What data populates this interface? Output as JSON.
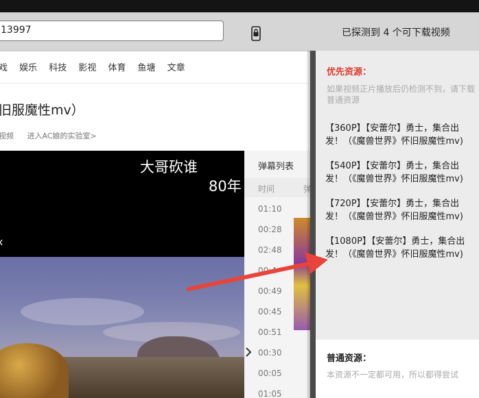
{
  "toolbar": {
    "url": "13997",
    "phone_icon": "phone-lock-icon",
    "detect_text": "已探测到 4 个可下载视频"
  },
  "nav": {
    "items": [
      "戏",
      "娱乐",
      "科技",
      "影视",
      "体育",
      "鱼塘",
      "文章"
    ]
  },
  "video": {
    "title": "旧服魔性mv）",
    "links": [
      "视频",
      "进入AC娘的实验室>"
    ],
    "danmaku": [
      "大哥砍谁",
      "80年",
      "x"
    ]
  },
  "danmu_panel": {
    "title": "弹幕列表",
    "col_time": "时间",
    "col_content": "弹",
    "times": [
      "01:10",
      "00:28",
      "02:48",
      "00:4",
      "00:49",
      "00:45",
      "00:51",
      "00:30",
      "00:05",
      "01:05"
    ],
    "chevron": "chevron-right-icon"
  },
  "overlay": {
    "priority_title": "优先资源：",
    "priority_desc": "如果视频正片播放后仍检测不到，请下载普通资源",
    "resources": [
      "【360P】【安蕾尔】勇士，集合出发！（《魔兽世界》怀旧服魔性mv)",
      "【540P】【安蕾尔】勇士，集合出发！（《魔兽世界》怀旧服魔性mv)",
      "【720P】【安蕾尔】勇士，集合出发！（《魔兽世界》怀旧服魔性mv)",
      "【1080P】【安蕾尔】勇士，集合出发！（《魔兽世界》怀旧服魔性mv)"
    ],
    "normal_title": "普通资源：",
    "normal_desc": "本资源不一定都可用，所以都得尝试"
  },
  "colors": {
    "priority_red": "#e03b2e",
    "arrow_red": "#e8443a"
  }
}
